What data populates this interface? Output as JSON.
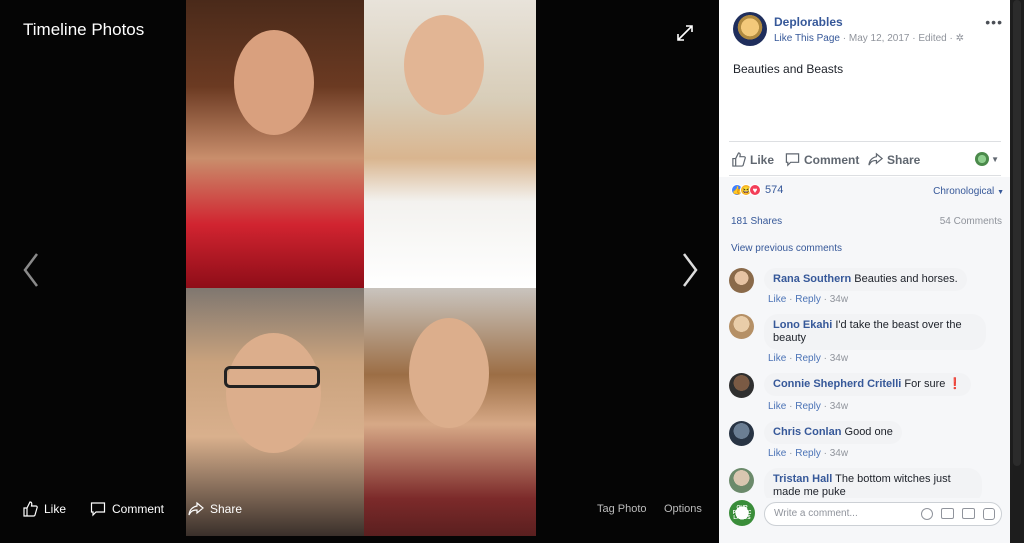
{
  "viewer": {
    "title": "Timeline Photos",
    "toolbar": {
      "like": "Like",
      "comment": "Comment",
      "share": "Share",
      "tag_photo": "Tag Photo",
      "options": "Options"
    }
  },
  "post": {
    "page_name": "Deplorables",
    "like_page": "Like This Page",
    "date": "May 12, 2017",
    "edited": "Edited",
    "text": "Beauties and Beasts",
    "actions": {
      "like": "Like",
      "comment": "Comment",
      "share": "Share"
    },
    "reaction_count": "574",
    "sort": "Chronological",
    "shares": "181 Shares",
    "comments_count": "54 Comments",
    "view_previous": "View previous comments"
  },
  "comments": [
    {
      "name": "Rana Southern",
      "text": "Beauties and horses.",
      "like": "Like",
      "reply": "Reply",
      "time": "34w"
    },
    {
      "name": "Lono Ekahi",
      "text": "I'd take the beast over the beauty",
      "like": "Like",
      "reply": "Reply",
      "time": "34w"
    },
    {
      "name": "Connie Shepherd Critelli",
      "text": "For sure ❗",
      "like": "Like",
      "reply": "Reply",
      "time": "34w"
    },
    {
      "name": "Chris Conlan",
      "text": "Good one",
      "like": "Like",
      "reply": "Reply",
      "time": "34w"
    },
    {
      "name": "Tristan Hall",
      "text": "The bottom witches just made me puke"
    }
  ],
  "writer": {
    "placeholder": "Write a comment...",
    "avatar_text": "OUR PUBLIC LANDS"
  },
  "colors": {
    "link": "#365899",
    "panel_bg": "#f6f7f9",
    "viewer_bg": "#050505"
  }
}
